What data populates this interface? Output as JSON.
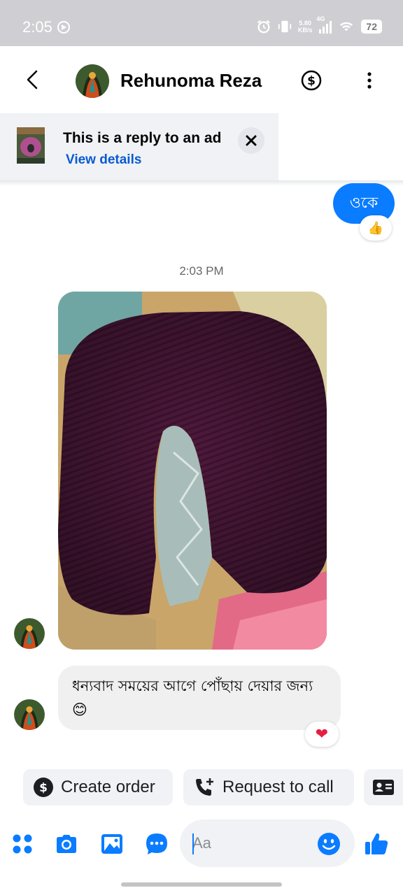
{
  "status_bar": {
    "time": "2:05",
    "net_speed_value": "5.80",
    "net_speed_unit": "KB/s",
    "network": "4G",
    "battery": "72"
  },
  "header": {
    "contact_name": "Rehunoma Reza"
  },
  "ad_banner": {
    "title": "This is a reply to an ad",
    "link": "View details"
  },
  "messages": {
    "outgoing_text": "ওকে",
    "outgoing_reaction": "👍",
    "timestamp": "2:03 PM",
    "incoming_text": "ধন্যবাদ সময়ের আগে পোঁছায় দেয়ার জন্য 😊",
    "incoming_reaction": "❤"
  },
  "quick_actions": {
    "create_order": "Create order",
    "request_call": "Request to call"
  },
  "composer": {
    "placeholder": "Aa"
  },
  "colors": {
    "accent": "#0a7cff",
    "link": "#0a5ad2",
    "reaction_heart": "#e41e3f"
  },
  "icons": [
    "back-icon",
    "dollar-icon",
    "more-icon",
    "close-icon",
    "menu-dots-icon",
    "camera-icon",
    "image-icon",
    "chat-icon",
    "emoji-icon",
    "like-icon",
    "phone-plus-icon",
    "contact-card-icon"
  ]
}
